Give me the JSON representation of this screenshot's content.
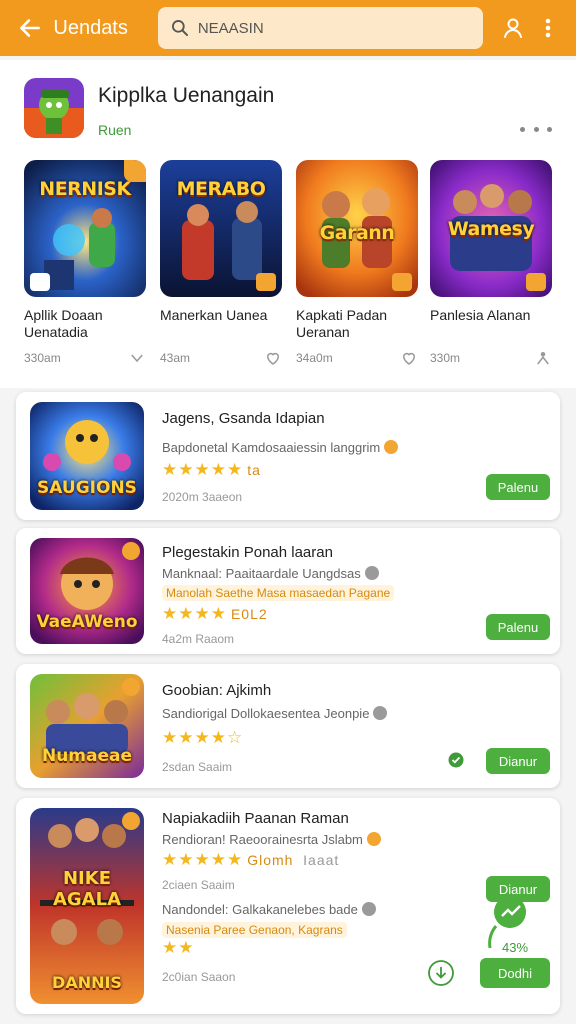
{
  "header": {
    "title": "Uendats",
    "search_value": "NEAASIN",
    "search_placeholder": "NEAASIN"
  },
  "featured": {
    "title": "Kipplka Uenangain",
    "subtitle": "Ruen",
    "tiles": [
      {
        "art_label": "NERNISK",
        "name": "Apllik Doaan Uenatadia",
        "count": "330am"
      },
      {
        "art_label": "MERABO",
        "name": "Manerkan Uanea",
        "count": "43am"
      },
      {
        "art_label": "Garann",
        "name": "Kapkati Padan Ueranan",
        "count": "34a0m"
      },
      {
        "art_label": "Wamesy",
        "name": "Panlesia Alanan",
        "count": "330m"
      }
    ]
  },
  "list": [
    {
      "art_label": "SAUGIONS",
      "title": "Jagens, Gsanda Idapian",
      "desc": "Bapdonetal Kamdosaaiessin langgrim",
      "stars_text": "ta",
      "date": "2020m 3aaeon",
      "button": "Palenu"
    },
    {
      "art_label": "VaeAWeno",
      "title": "Plegestakin Ponah laaran",
      "desc": "Manknaal: Paaitaardale Uangdsas",
      "tags": "Manolah Saethe Masa masaedan",
      "tag_extra": "Pagane",
      "stars_text": "E0L2",
      "date": "4a2m Raaom",
      "button": "Palenu"
    },
    {
      "art_label": "Numaeae",
      "title": "Goobian: Ajkimh",
      "desc": "Sandiorigal Dollokaesentea Jeonpie",
      "date": "2sdan Saaim",
      "button": "Dianur"
    },
    {
      "art_label": "AGALA",
      "title": "Napiakadiih Paanan Raman",
      "desc": "Rendioran! Raeoorainesrta Jslabm",
      "stars_text": "Glomh",
      "stars_extra": "Iaaat",
      "date": "2ciaen Saaim",
      "button": "Dianur"
    },
    {
      "art_label": "DANNIS",
      "title": "",
      "desc": "Nandondel: Galkakanelebes bade",
      "tags": "Nasenia Paree Genaon,",
      "tag_extra": "Kagrans",
      "stars_text": "",
      "progress_label": "43%",
      "progress": 0.43,
      "date": "2c0ian Saaon",
      "button": "Dodhi"
    }
  ]
}
